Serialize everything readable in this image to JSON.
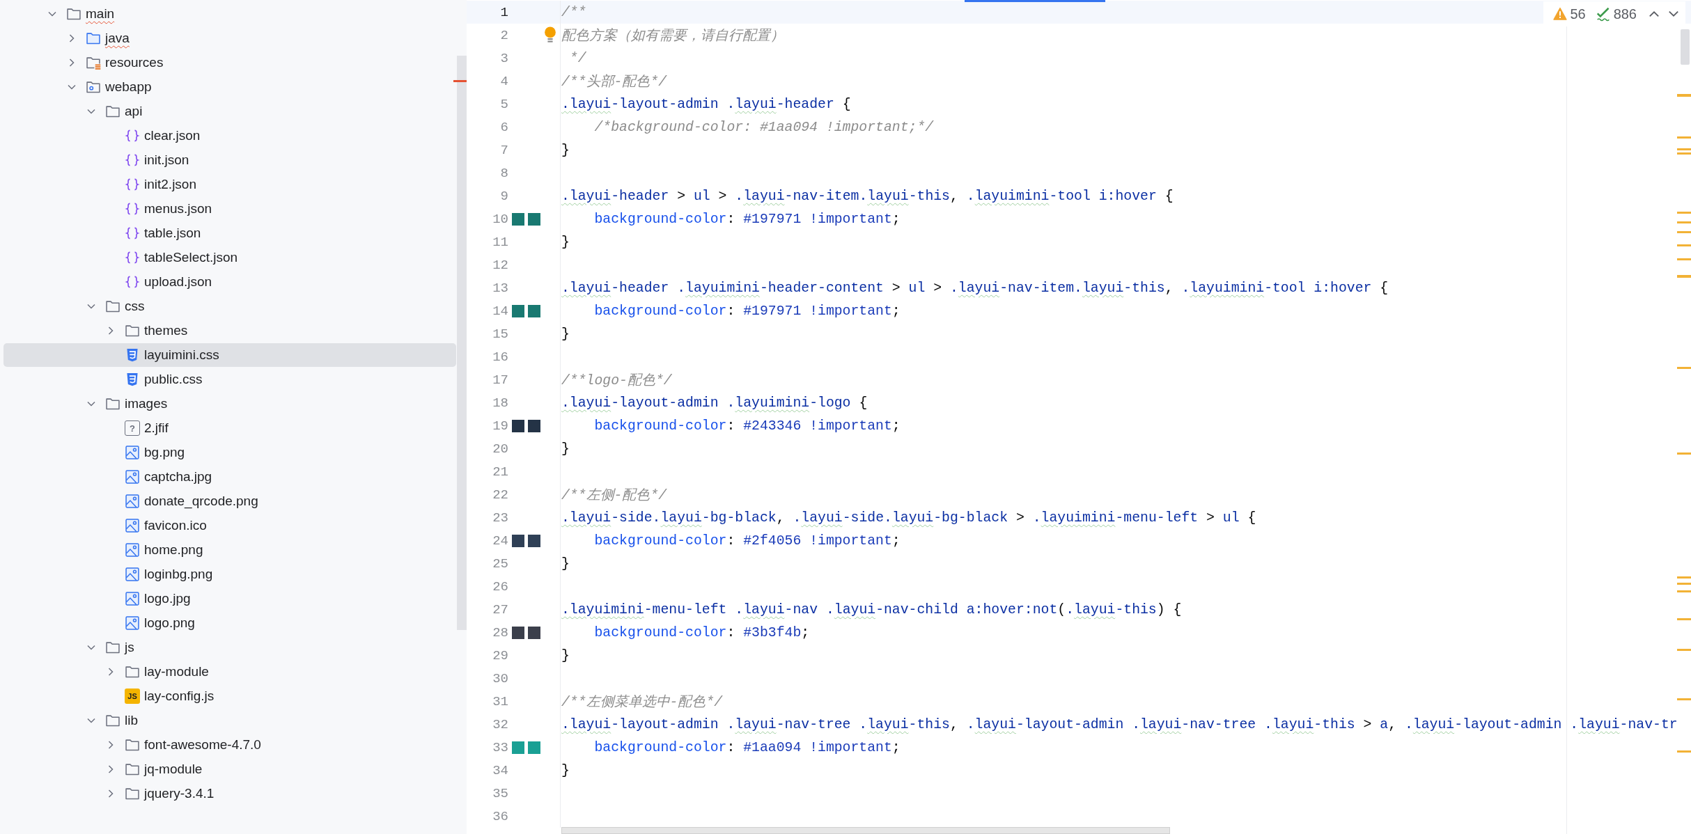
{
  "tree": [
    {
      "name": "main",
      "kind": "folder",
      "expanded": true,
      "selected": false,
      "spell_error": true,
      "children": [
        {
          "name": "java",
          "kind": "source-folder",
          "expanded": false,
          "selected": false,
          "spell_error": true
        },
        {
          "name": "resources",
          "kind": "resource-folder",
          "expanded": false,
          "selected": false,
          "spell_error": false
        },
        {
          "name": "webapp",
          "kind": "web-folder",
          "expanded": true,
          "selected": false,
          "spell_error": false,
          "children": [
            {
              "name": "api",
              "kind": "folder",
              "expanded": true,
              "selected": false,
              "spell_error": false,
              "children": [
                {
                  "name": "clear.json",
                  "kind": "json",
                  "selected": false,
                  "spell_error": false
                },
                {
                  "name": "init.json",
                  "kind": "json",
                  "selected": false,
                  "spell_error": false
                },
                {
                  "name": "init2.json",
                  "kind": "json",
                  "selected": false,
                  "spell_error": false
                },
                {
                  "name": "menus.json",
                  "kind": "json",
                  "selected": false,
                  "spell_error": false
                },
                {
                  "name": "table.json",
                  "kind": "json",
                  "selected": false,
                  "spell_error": false
                },
                {
                  "name": "tableSelect.json",
                  "kind": "json",
                  "selected": false,
                  "spell_error": false
                },
                {
                  "name": "upload.json",
                  "kind": "json",
                  "selected": false,
                  "spell_error": false
                }
              ]
            },
            {
              "name": "css",
              "kind": "folder",
              "expanded": true,
              "selected": false,
              "spell_error": false,
              "children": [
                {
                  "name": "themes",
                  "kind": "folder",
                  "expanded": false,
                  "selected": false,
                  "spell_error": false
                },
                {
                  "name": "layuimini.css",
                  "kind": "css",
                  "selected": true,
                  "spell_error": false
                },
                {
                  "name": "public.css",
                  "kind": "css",
                  "selected": false,
                  "spell_error": false
                }
              ]
            },
            {
              "name": "images",
              "kind": "folder",
              "expanded": true,
              "selected": false,
              "spell_error": false,
              "children": [
                {
                  "name": "2.jfif",
                  "kind": "unknown",
                  "icon_label": "?",
                  "selected": false,
                  "spell_error": false
                },
                {
                  "name": "bg.png",
                  "kind": "image",
                  "selected": false,
                  "spell_error": false
                },
                {
                  "name": "captcha.jpg",
                  "kind": "image",
                  "selected": false,
                  "spell_error": false
                },
                {
                  "name": "donate_qrcode.png",
                  "kind": "image",
                  "selected": false,
                  "spell_error": false
                },
                {
                  "name": "favicon.ico",
                  "kind": "image",
                  "selected": false,
                  "spell_error": false
                },
                {
                  "name": "home.png",
                  "kind": "image",
                  "selected": false,
                  "spell_error": false
                },
                {
                  "name": "loginbg.png",
                  "kind": "image",
                  "selected": false,
                  "spell_error": false
                },
                {
                  "name": "logo.jpg",
                  "kind": "image",
                  "selected": false,
                  "spell_error": false
                },
                {
                  "name": "logo.png",
                  "kind": "image",
                  "selected": false,
                  "spell_error": false
                }
              ]
            },
            {
              "name": "js",
              "kind": "folder",
              "expanded": true,
              "selected": false,
              "spell_error": false,
              "children": [
                {
                  "name": "lay-module",
                  "kind": "folder",
                  "expanded": false,
                  "selected": false,
                  "spell_error": false
                },
                {
                  "name": "lay-config.js",
                  "kind": "js",
                  "icon_label": "JS",
                  "selected": false,
                  "spell_error": false
                }
              ]
            },
            {
              "name": "lib",
              "kind": "folder",
              "expanded": true,
              "selected": false,
              "spell_error": false,
              "children": [
                {
                  "name": "font-awesome-4.7.0",
                  "kind": "folder",
                  "expanded": false,
                  "selected": false,
                  "spell_error": false
                },
                {
                  "name": "jq-module",
                  "kind": "folder",
                  "expanded": false,
                  "selected": false,
                  "spell_error": false
                },
                {
                  "name": "jquery-3.4.1",
                  "kind": "folder",
                  "expanded": false,
                  "selected": false,
                  "spell_error": false
                }
              ]
            }
          ]
        }
      ]
    }
  ],
  "inspections": {
    "warnings": "56",
    "passed": "886"
  },
  "editor": {
    "lines": [
      {
        "number": "1",
        "current": true,
        "segments": [
          {
            "kind": "comment",
            "text": "/**"
          }
        ]
      },
      {
        "number": "2",
        "current": false,
        "bulb": true,
        "segments": [
          {
            "kind": "comment",
            "text": "配色方案（如有需要，请自行配置）"
          }
        ]
      },
      {
        "number": "3",
        "current": false,
        "segments": [
          {
            "kind": "comment",
            "text": " */"
          }
        ]
      },
      {
        "number": "4",
        "current": false,
        "segments": [
          {
            "kind": "comment",
            "text": "/**头部-配色*/"
          }
        ]
      },
      {
        "number": "5",
        "current": false,
        "segments": [
          {
            "kind": "flagged",
            "text": ".layui"
          },
          {
            "kind": "name",
            "text": "-layout-admin ."
          },
          {
            "kind": "flagged",
            "text": "layui"
          },
          {
            "kind": "name",
            "text": "-header "
          },
          {
            "kind": "punct",
            "text": "{"
          }
        ]
      },
      {
        "number": "6",
        "current": false,
        "segments": [
          {
            "kind": "comment",
            "text": "    /*background-color: #1aa094 !important;*/"
          }
        ]
      },
      {
        "number": "7",
        "current": false,
        "segments": [
          {
            "kind": "punct",
            "text": "}"
          }
        ]
      },
      {
        "number": "8",
        "current": false
      },
      {
        "number": "9",
        "current": false,
        "segments": [
          {
            "kind": "flagged",
            "text": ".layui"
          },
          {
            "kind": "name",
            "text": "-header "
          },
          {
            "kind": "punct",
            "text": "> "
          },
          {
            "kind": "name",
            "text": "ul "
          },
          {
            "kind": "punct",
            "text": "> "
          },
          {
            "kind": "name",
            "text": "."
          },
          {
            "kind": "flagged",
            "text": "layui"
          },
          {
            "kind": "name",
            "text": "-nav-item."
          },
          {
            "kind": "flagged",
            "text": "layui"
          },
          {
            "kind": "name",
            "text": "-this"
          },
          {
            "kind": "punct",
            "text": ", "
          },
          {
            "kind": "name",
            "text": "."
          },
          {
            "kind": "flagged",
            "text": "layuimini"
          },
          {
            "kind": "name",
            "text": "-tool i:hover "
          },
          {
            "kind": "punct",
            "text": "{"
          }
        ]
      },
      {
        "number": "10",
        "current": false,
        "color": "#197971",
        "segments": [
          {
            "kind": "property",
            "text": "    background-color"
          },
          {
            "kind": "punct",
            "text": ": "
          },
          {
            "kind": "value",
            "text": "#197971 !important"
          },
          {
            "kind": "punct",
            "text": ";"
          }
        ]
      },
      {
        "number": "11",
        "current": false,
        "segments": [
          {
            "kind": "punct",
            "text": "}"
          }
        ]
      },
      {
        "number": "12",
        "current": false
      },
      {
        "number": "13",
        "current": false,
        "segments": [
          {
            "kind": "flagged",
            "text": ".layui"
          },
          {
            "kind": "name",
            "text": "-header ."
          },
          {
            "kind": "flagged",
            "text": "layuimini"
          },
          {
            "kind": "name",
            "text": "-header-content "
          },
          {
            "kind": "punct",
            "text": "> "
          },
          {
            "kind": "name",
            "text": "ul "
          },
          {
            "kind": "punct",
            "text": "> "
          },
          {
            "kind": "name",
            "text": "."
          },
          {
            "kind": "flagged",
            "text": "layui"
          },
          {
            "kind": "name",
            "text": "-nav-item."
          },
          {
            "kind": "flagged",
            "text": "layui"
          },
          {
            "kind": "name",
            "text": "-this"
          },
          {
            "kind": "punct",
            "text": ", "
          },
          {
            "kind": "name",
            "text": "."
          },
          {
            "kind": "flagged",
            "text": "layuimini"
          },
          {
            "kind": "name",
            "text": "-tool i:hover "
          },
          {
            "kind": "punct",
            "text": "{"
          }
        ]
      },
      {
        "number": "14",
        "current": false,
        "color": "#197971",
        "segments": [
          {
            "kind": "property",
            "text": "    background-color"
          },
          {
            "kind": "punct",
            "text": ": "
          },
          {
            "kind": "value",
            "text": "#197971 !important"
          },
          {
            "kind": "punct",
            "text": ";"
          }
        ]
      },
      {
        "number": "15",
        "current": false,
        "segments": [
          {
            "kind": "punct",
            "text": "}"
          }
        ]
      },
      {
        "number": "16",
        "current": false
      },
      {
        "number": "17",
        "current": false,
        "segments": [
          {
            "kind": "comment",
            "text": "/**logo-配色*/"
          }
        ]
      },
      {
        "number": "18",
        "current": false,
        "segments": [
          {
            "kind": "flagged",
            "text": ".layui"
          },
          {
            "kind": "name",
            "text": "-layout-admin ."
          },
          {
            "kind": "flagged",
            "text": "layuimini"
          },
          {
            "kind": "name",
            "text": "-logo "
          },
          {
            "kind": "punct",
            "text": "{"
          }
        ]
      },
      {
        "number": "19",
        "current": false,
        "color": "#243346",
        "segments": [
          {
            "kind": "property",
            "text": "    background-color"
          },
          {
            "kind": "punct",
            "text": ": "
          },
          {
            "kind": "value",
            "text": "#243346 !important"
          },
          {
            "kind": "punct",
            "text": ";"
          }
        ]
      },
      {
        "number": "20",
        "current": false,
        "segments": [
          {
            "kind": "punct",
            "text": "}"
          }
        ]
      },
      {
        "number": "21",
        "current": false
      },
      {
        "number": "22",
        "current": false,
        "segments": [
          {
            "kind": "comment",
            "text": "/**左侧-配色*/"
          }
        ]
      },
      {
        "number": "23",
        "current": false,
        "segments": [
          {
            "kind": "flagged",
            "text": ".layui"
          },
          {
            "kind": "name",
            "text": "-side."
          },
          {
            "kind": "flagged",
            "text": "layui"
          },
          {
            "kind": "name",
            "text": "-bg-black"
          },
          {
            "kind": "punct",
            "text": ", "
          },
          {
            "kind": "name",
            "text": "."
          },
          {
            "kind": "flagged",
            "text": "layui"
          },
          {
            "kind": "name",
            "text": "-side."
          },
          {
            "kind": "flagged",
            "text": "layui"
          },
          {
            "kind": "name",
            "text": "-bg-black "
          },
          {
            "kind": "punct",
            "text": "> "
          },
          {
            "kind": "name",
            "text": "."
          },
          {
            "kind": "flagged",
            "text": "layuimini"
          },
          {
            "kind": "name",
            "text": "-menu-left "
          },
          {
            "kind": "punct",
            "text": "> "
          },
          {
            "kind": "name",
            "text": "ul "
          },
          {
            "kind": "punct",
            "text": "{"
          }
        ]
      },
      {
        "number": "24",
        "current": false,
        "color": "#2f4056",
        "segments": [
          {
            "kind": "property",
            "text": "    background-color"
          },
          {
            "kind": "punct",
            "text": ": "
          },
          {
            "kind": "value",
            "text": "#2f4056 !important"
          },
          {
            "kind": "punct",
            "text": ";"
          }
        ]
      },
      {
        "number": "25",
        "current": false,
        "segments": [
          {
            "kind": "punct",
            "text": "}"
          }
        ]
      },
      {
        "number": "26",
        "current": false
      },
      {
        "number": "27",
        "current": false,
        "segments": [
          {
            "kind": "flagged",
            "text": ".layuimini"
          },
          {
            "kind": "name",
            "text": "-menu-left ."
          },
          {
            "kind": "flagged",
            "text": "layui"
          },
          {
            "kind": "name",
            "text": "-nav ."
          },
          {
            "kind": "flagged",
            "text": "layui"
          },
          {
            "kind": "name",
            "text": "-nav-child a:hover:not"
          },
          {
            "kind": "punct",
            "text": "("
          },
          {
            "kind": "name",
            "text": "."
          },
          {
            "kind": "flagged",
            "text": "layui"
          },
          {
            "kind": "name",
            "text": "-this"
          },
          {
            "kind": "punct",
            "text": ") {"
          }
        ]
      },
      {
        "number": "28",
        "current": false,
        "color": "#3b3f4b",
        "segments": [
          {
            "kind": "property",
            "text": "    background-color"
          },
          {
            "kind": "punct",
            "text": ": "
          },
          {
            "kind": "value",
            "text": "#3b3f4b"
          },
          {
            "kind": "punct",
            "text": ";"
          }
        ]
      },
      {
        "number": "29",
        "current": false,
        "segments": [
          {
            "kind": "punct",
            "text": "}"
          }
        ]
      },
      {
        "number": "30",
        "current": false
      },
      {
        "number": "31",
        "current": false,
        "segments": [
          {
            "kind": "comment",
            "text": "/**左侧菜单选中-配色*/"
          }
        ]
      },
      {
        "number": "32",
        "current": false,
        "segments": [
          {
            "kind": "flagged",
            "text": ".layui"
          },
          {
            "kind": "name",
            "text": "-layout-admin ."
          },
          {
            "kind": "flagged",
            "text": "layui"
          },
          {
            "kind": "name",
            "text": "-nav-tree ."
          },
          {
            "kind": "flagged",
            "text": "layui"
          },
          {
            "kind": "name",
            "text": "-this"
          },
          {
            "kind": "punct",
            "text": ", "
          },
          {
            "kind": "name",
            "text": "."
          },
          {
            "kind": "flagged",
            "text": "layui"
          },
          {
            "kind": "name",
            "text": "-layout-admin ."
          },
          {
            "kind": "flagged",
            "text": "layui"
          },
          {
            "kind": "name",
            "text": "-nav-tree ."
          },
          {
            "kind": "flagged",
            "text": "layui"
          },
          {
            "kind": "name",
            "text": "-this "
          },
          {
            "kind": "punct",
            "text": "> "
          },
          {
            "kind": "name",
            "text": "a"
          },
          {
            "kind": "punct",
            "text": ", "
          },
          {
            "kind": "name",
            "text": "."
          },
          {
            "kind": "flagged",
            "text": "layui"
          },
          {
            "kind": "name",
            "text": "-layout-admin ."
          },
          {
            "kind": "flagged",
            "text": "layui"
          },
          {
            "kind": "name",
            "text": "-nav-tr"
          }
        ]
      },
      {
        "number": "33",
        "current": false,
        "color": "#1aa094",
        "segments": [
          {
            "kind": "property",
            "text": "    background-color"
          },
          {
            "kind": "punct",
            "text": ": "
          },
          {
            "kind": "value",
            "text": "#1aa094 !important"
          },
          {
            "kind": "punct",
            "text": ";"
          }
        ]
      },
      {
        "number": "34",
        "current": false,
        "segments": [
          {
            "kind": "punct",
            "text": "}"
          }
        ]
      },
      {
        "number": "35",
        "current": false
      },
      {
        "number": "36",
        "current": false
      }
    ]
  }
}
